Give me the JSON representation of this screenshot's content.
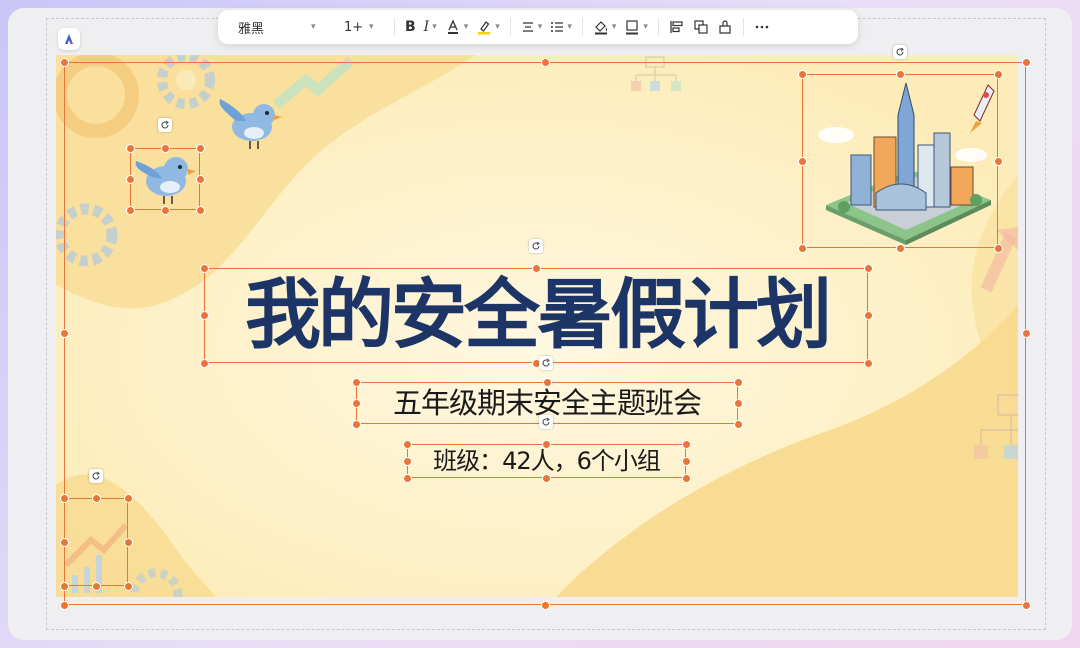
{
  "toolbar": {
    "font_family": "雅黑",
    "font_size": "1+",
    "icons": [
      "bold-icon",
      "italic-icon",
      "font-color-icon",
      "highlight-icon",
      "align-center-icon",
      "list-icon",
      "fill-icon",
      "border-icon",
      "align-left-icon",
      "arrange-icon",
      "shape-icon",
      "more-icon"
    ]
  },
  "slide": {
    "title": "我的安全暑假计划",
    "subtitle": "五年级期末安全主题班会",
    "class_info": "班级：42人，6个小组"
  },
  "colors": {
    "title": "#1c3566",
    "selection": "#e8753a",
    "slide_bg": "#fdf1c8",
    "blob": "#f8d98e"
  }
}
